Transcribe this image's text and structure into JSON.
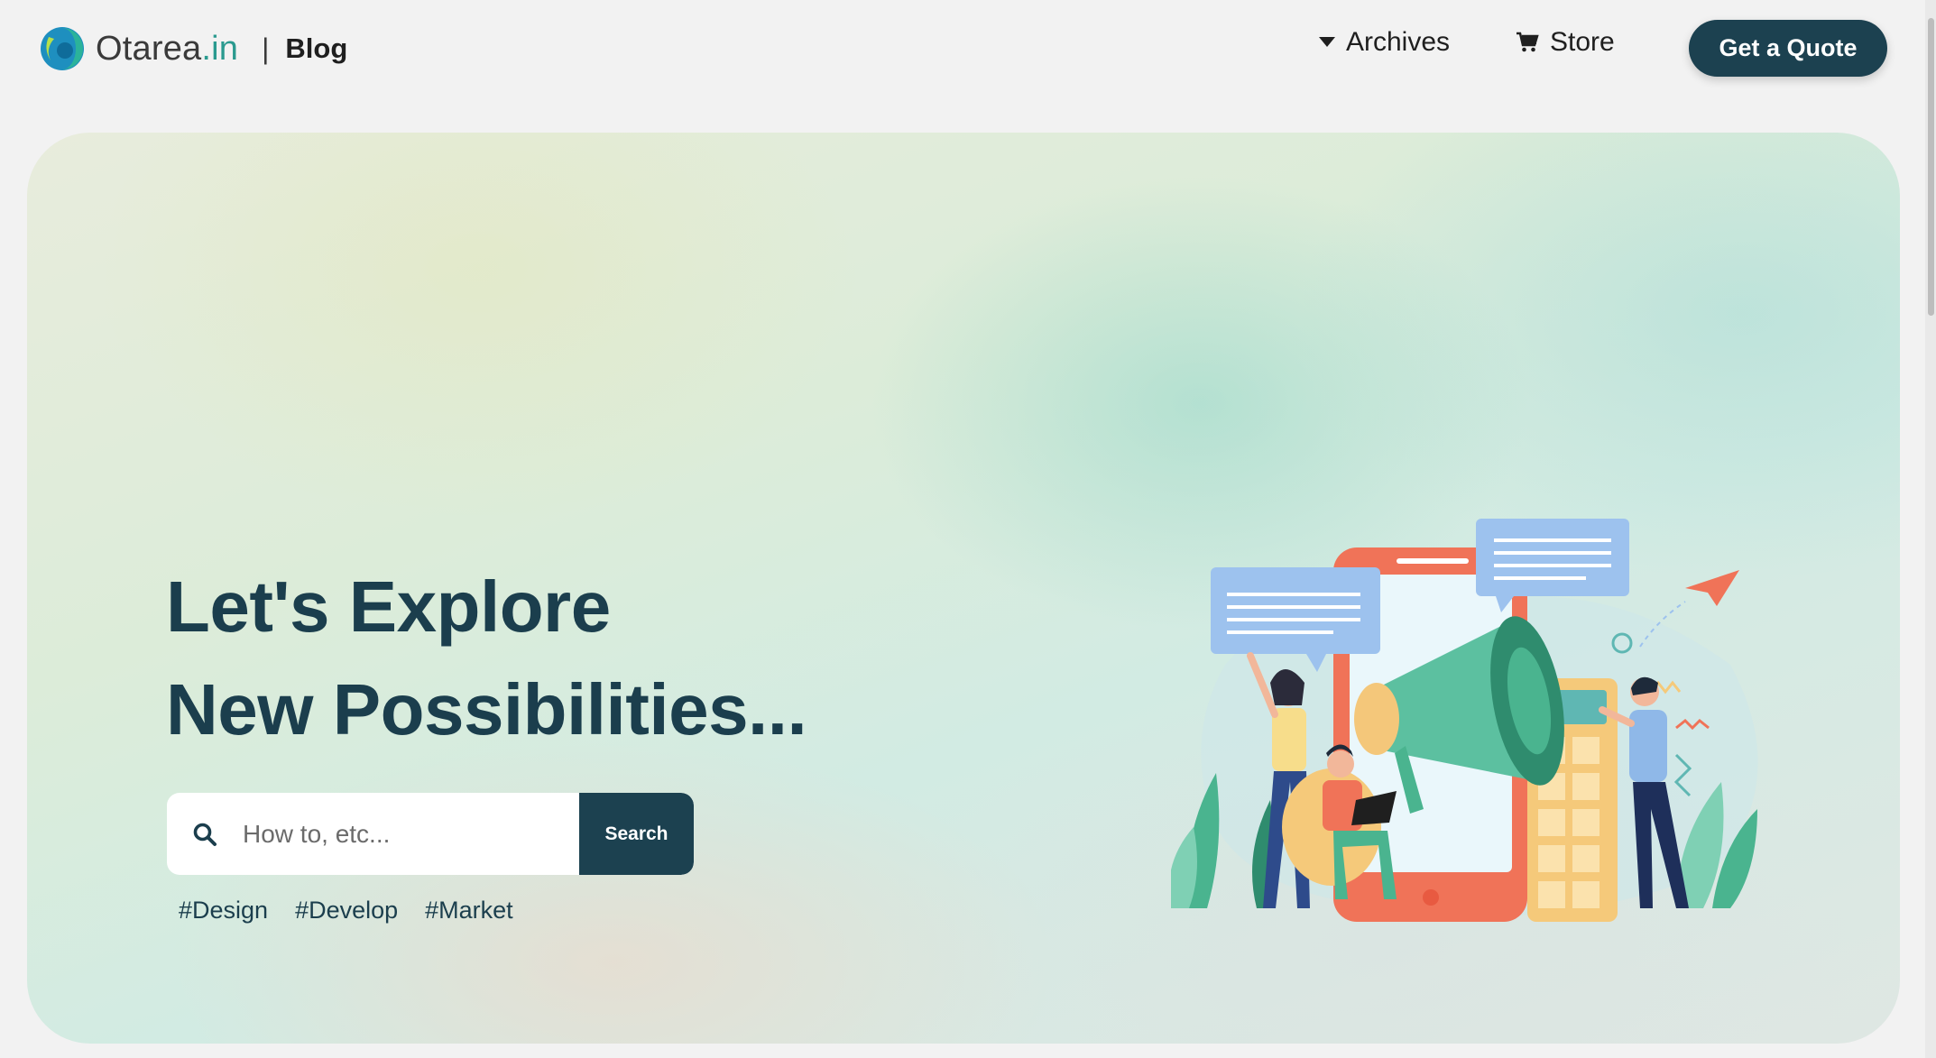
{
  "header": {
    "brand_main": "Otarea",
    "brand_tld": ".in",
    "separator": "|",
    "section": "Blog",
    "nav": {
      "archives": "Archives",
      "store": "Store"
    },
    "cta": "Get a Quote"
  },
  "hero": {
    "title_line1": "Let's Explore",
    "title_line2": "New Possibilities...",
    "search": {
      "placeholder": "How to, etc...",
      "button": "Search"
    },
    "tags": [
      "#Design",
      "#Develop",
      "#Market"
    ]
  },
  "icons": {
    "logo": "otarea-logo-icon",
    "archives": "caret-down-icon",
    "store": "cart-icon",
    "search": "search-icon",
    "illustration": "megaphone-marketing-illustration"
  },
  "colors": {
    "primary": "#1c4150",
    "accent": "#2a9a8f",
    "page_bg": "#f2f2f2"
  }
}
